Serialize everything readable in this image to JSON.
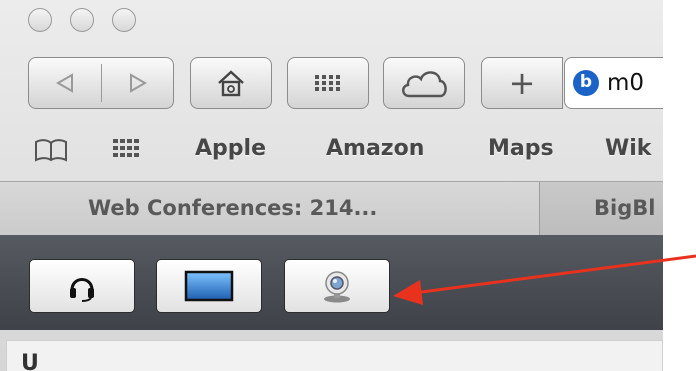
{
  "window": {
    "traffic_lights": [
      "close",
      "minimize",
      "zoom"
    ]
  },
  "toolbar": {
    "back_icon": "back-arrow-icon",
    "forward_icon": "forward-arrow-icon",
    "home_icon": "home-icon",
    "top_sites_icon": "grid-icon",
    "icloud_icon": "cloud-icon",
    "add_icon": "plus-icon",
    "add_label": "+",
    "address": {
      "site_icon": "bigbluebutton-logo",
      "site_icon_glyph": "b",
      "text": "m0"
    }
  },
  "bookmarks": {
    "reading_list_icon": "book-icon",
    "top_sites_icon": "grid-icon",
    "items": [
      "Apple",
      "Amazon",
      "Maps",
      "Wik"
    ]
  },
  "tabs": [
    {
      "label": "Web Conferences: 214...",
      "active": true
    },
    {
      "label": "BigBl",
      "active": false
    }
  ],
  "app_toolbar": {
    "buttons": [
      {
        "icon": "headset-icon",
        "name": "audio"
      },
      {
        "icon": "desktop-screen-icon",
        "name": "share-screen"
      },
      {
        "icon": "webcam-icon",
        "name": "webcam"
      }
    ]
  },
  "content": {
    "text": "U"
  },
  "annotation": {
    "type": "arrow",
    "color": "#e8321e",
    "points_to": "webcam-button"
  },
  "colors": {
    "app_toolbar_bg": "#4a4d53",
    "screen_blue": "#2f7fd4",
    "brand_blue": "#1c63c7"
  }
}
